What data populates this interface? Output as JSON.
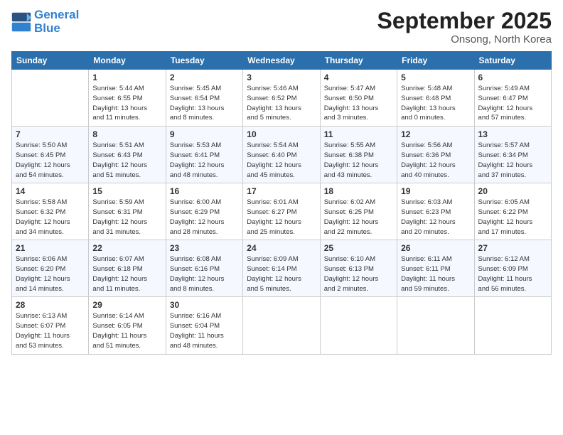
{
  "logo": {
    "line1": "General",
    "line2": "Blue"
  },
  "title": "September 2025",
  "location": "Onsong, North Korea",
  "days_of_week": [
    "Sunday",
    "Monday",
    "Tuesday",
    "Wednesday",
    "Thursday",
    "Friday",
    "Saturday"
  ],
  "weeks": [
    [
      {
        "day": "",
        "info": ""
      },
      {
        "day": "1",
        "info": "Sunrise: 5:44 AM\nSunset: 6:55 PM\nDaylight: 13 hours\nand 11 minutes."
      },
      {
        "day": "2",
        "info": "Sunrise: 5:45 AM\nSunset: 6:54 PM\nDaylight: 13 hours\nand 8 minutes."
      },
      {
        "day": "3",
        "info": "Sunrise: 5:46 AM\nSunset: 6:52 PM\nDaylight: 13 hours\nand 5 minutes."
      },
      {
        "day": "4",
        "info": "Sunrise: 5:47 AM\nSunset: 6:50 PM\nDaylight: 13 hours\nand 3 minutes."
      },
      {
        "day": "5",
        "info": "Sunrise: 5:48 AM\nSunset: 6:48 PM\nDaylight: 13 hours\nand 0 minutes."
      },
      {
        "day": "6",
        "info": "Sunrise: 5:49 AM\nSunset: 6:47 PM\nDaylight: 12 hours\nand 57 minutes."
      }
    ],
    [
      {
        "day": "7",
        "info": "Sunrise: 5:50 AM\nSunset: 6:45 PM\nDaylight: 12 hours\nand 54 minutes."
      },
      {
        "day": "8",
        "info": "Sunrise: 5:51 AM\nSunset: 6:43 PM\nDaylight: 12 hours\nand 51 minutes."
      },
      {
        "day": "9",
        "info": "Sunrise: 5:53 AM\nSunset: 6:41 PM\nDaylight: 12 hours\nand 48 minutes."
      },
      {
        "day": "10",
        "info": "Sunrise: 5:54 AM\nSunset: 6:40 PM\nDaylight: 12 hours\nand 45 minutes."
      },
      {
        "day": "11",
        "info": "Sunrise: 5:55 AM\nSunset: 6:38 PM\nDaylight: 12 hours\nand 43 minutes."
      },
      {
        "day": "12",
        "info": "Sunrise: 5:56 AM\nSunset: 6:36 PM\nDaylight: 12 hours\nand 40 minutes."
      },
      {
        "day": "13",
        "info": "Sunrise: 5:57 AM\nSunset: 6:34 PM\nDaylight: 12 hours\nand 37 minutes."
      }
    ],
    [
      {
        "day": "14",
        "info": "Sunrise: 5:58 AM\nSunset: 6:32 PM\nDaylight: 12 hours\nand 34 minutes."
      },
      {
        "day": "15",
        "info": "Sunrise: 5:59 AM\nSunset: 6:31 PM\nDaylight: 12 hours\nand 31 minutes."
      },
      {
        "day": "16",
        "info": "Sunrise: 6:00 AM\nSunset: 6:29 PM\nDaylight: 12 hours\nand 28 minutes."
      },
      {
        "day": "17",
        "info": "Sunrise: 6:01 AM\nSunset: 6:27 PM\nDaylight: 12 hours\nand 25 minutes."
      },
      {
        "day": "18",
        "info": "Sunrise: 6:02 AM\nSunset: 6:25 PM\nDaylight: 12 hours\nand 22 minutes."
      },
      {
        "day": "19",
        "info": "Sunrise: 6:03 AM\nSunset: 6:23 PM\nDaylight: 12 hours\nand 20 minutes."
      },
      {
        "day": "20",
        "info": "Sunrise: 6:05 AM\nSunset: 6:22 PM\nDaylight: 12 hours\nand 17 minutes."
      }
    ],
    [
      {
        "day": "21",
        "info": "Sunrise: 6:06 AM\nSunset: 6:20 PM\nDaylight: 12 hours\nand 14 minutes."
      },
      {
        "day": "22",
        "info": "Sunrise: 6:07 AM\nSunset: 6:18 PM\nDaylight: 12 hours\nand 11 minutes."
      },
      {
        "day": "23",
        "info": "Sunrise: 6:08 AM\nSunset: 6:16 PM\nDaylight: 12 hours\nand 8 minutes."
      },
      {
        "day": "24",
        "info": "Sunrise: 6:09 AM\nSunset: 6:14 PM\nDaylight: 12 hours\nand 5 minutes."
      },
      {
        "day": "25",
        "info": "Sunrise: 6:10 AM\nSunset: 6:13 PM\nDaylight: 12 hours\nand 2 minutes."
      },
      {
        "day": "26",
        "info": "Sunrise: 6:11 AM\nSunset: 6:11 PM\nDaylight: 11 hours\nand 59 minutes."
      },
      {
        "day": "27",
        "info": "Sunrise: 6:12 AM\nSunset: 6:09 PM\nDaylight: 11 hours\nand 56 minutes."
      }
    ],
    [
      {
        "day": "28",
        "info": "Sunrise: 6:13 AM\nSunset: 6:07 PM\nDaylight: 11 hours\nand 53 minutes."
      },
      {
        "day": "29",
        "info": "Sunrise: 6:14 AM\nSunset: 6:05 PM\nDaylight: 11 hours\nand 51 minutes."
      },
      {
        "day": "30",
        "info": "Sunrise: 6:16 AM\nSunset: 6:04 PM\nDaylight: 11 hours\nand 48 minutes."
      },
      {
        "day": "",
        "info": ""
      },
      {
        "day": "",
        "info": ""
      },
      {
        "day": "",
        "info": ""
      },
      {
        "day": "",
        "info": ""
      }
    ]
  ]
}
